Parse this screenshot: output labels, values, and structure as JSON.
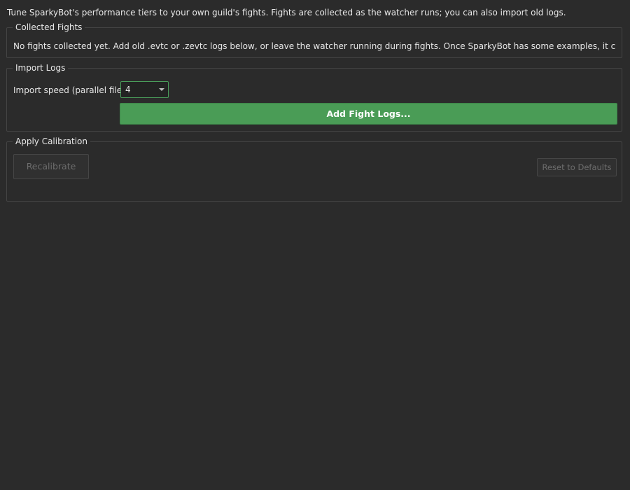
{
  "intro_text": "Tune SparkyBot's performance tiers to your own guild's fights. Fights are collected as the watcher runs; you can also import old logs.",
  "collected": {
    "title": "Collected Fights",
    "status_text": "No fights collected yet. Add old .evtc or .zevtc logs below, or leave the watcher running during fights. Once SparkyBot has some examples, it can tune its ratings to y"
  },
  "import_logs": {
    "title": "Import Logs",
    "speed_label": "Import speed (parallel files):",
    "speed_value": "4",
    "add_button_label": "Add Fight Logs..."
  },
  "apply": {
    "title": "Apply Calibration",
    "recalibrate_label": "Recalibrate",
    "reset_label": "Reset to Defaults"
  },
  "colors": {
    "background": "#2b2b2b",
    "accent_green": "#4a9c56",
    "border": "#444444",
    "disabled_text": "#6d6d6d"
  }
}
